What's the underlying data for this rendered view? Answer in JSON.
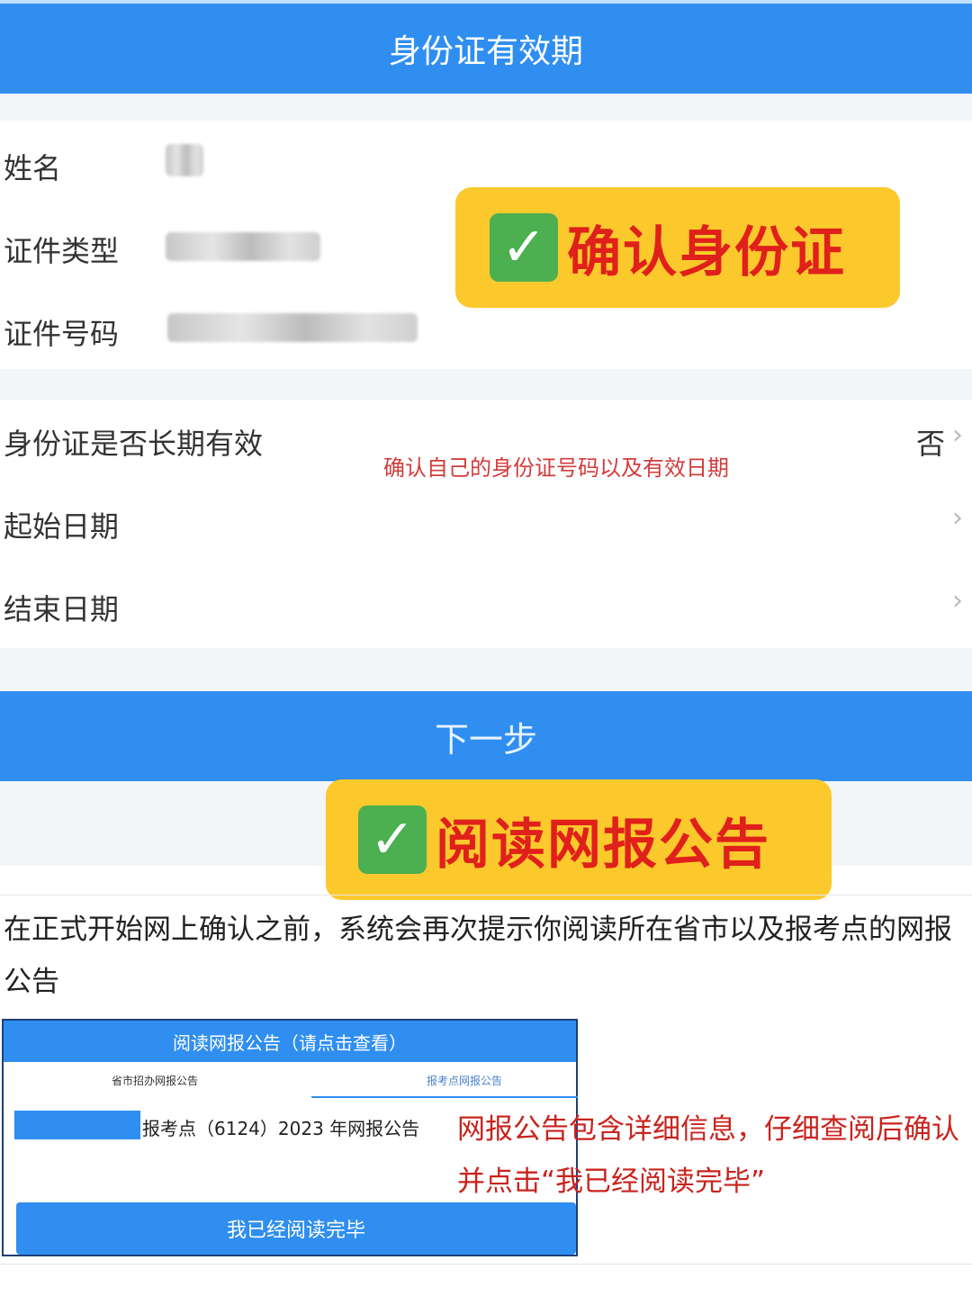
{
  "header": {
    "title": "身份证有效期"
  },
  "identity": {
    "name_label": "姓名",
    "id_type_label": "证件类型",
    "id_number_label": "证件号码"
  },
  "validity": {
    "long_term_label": "身份证是否长期有效",
    "long_term_value": "否",
    "start_label": "起始日期",
    "end_label": "结束日期",
    "chevron": "›"
  },
  "annotations": {
    "badge1": "确认身份证",
    "note1": "确认自己的身份证号码以及有效日期",
    "badge2": "阅读网报公告",
    "check_mark": "✓",
    "body": "在正式开始网上确认之前，系统会再次提示你阅读所在省市以及报考点的网报公告",
    "description": "网报公告包含详细信息，仔细查阅后确认并点击“我已经阅读完毕”"
  },
  "actions": {
    "next_label": "下一步"
  },
  "notice": {
    "title": "阅读网报公告（请点击查看）",
    "tab_province": "省市招办网报公告",
    "tab_site": "报考点网报公告",
    "line": "报考点（6124）2023 年网报公告",
    "confirm_label": "我已经阅读完毕"
  },
  "colors": {
    "primary": "#2f8ef0",
    "badge_bg": "#fcc92d",
    "badge_text": "#e0201b",
    "check_bg": "#4caf50",
    "annotation_red": "#c9231d"
  }
}
